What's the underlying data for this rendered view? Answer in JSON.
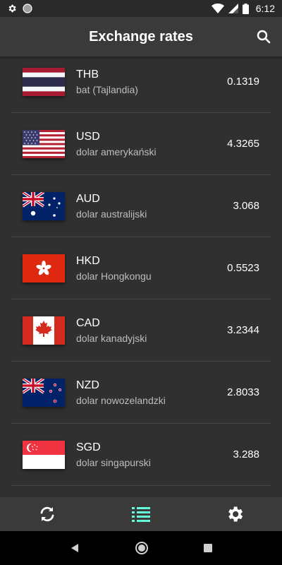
{
  "status": {
    "time": "6:12"
  },
  "app": {
    "title": "Exchange rates"
  },
  "currencies": [
    {
      "code": "THB",
      "name": "bat (Tajlandia)",
      "rate": "0.1319",
      "flag": "thailand"
    },
    {
      "code": "USD",
      "name": "dolar amerykański",
      "rate": "4.3265",
      "flag": "usa"
    },
    {
      "code": "AUD",
      "name": "dolar australijski",
      "rate": "3.068",
      "flag": "australia"
    },
    {
      "code": "HKD",
      "name": "dolar Hongkongu",
      "rate": "0.5523",
      "flag": "hong-kong"
    },
    {
      "code": "CAD",
      "name": "dolar kanadyjski",
      "rate": "3.2344",
      "flag": "canada"
    },
    {
      "code": "NZD",
      "name": "dolar nowozelandzki",
      "rate": "2.8033",
      "flag": "new-zealand"
    },
    {
      "code": "SGD",
      "name": "dolar singapurski",
      "rate": "3.288",
      "flag": "singapore"
    }
  ],
  "nav": {
    "items": [
      {
        "icon": "refresh-icon",
        "active": false
      },
      {
        "icon": "list-icon",
        "active": true
      },
      {
        "icon": "settings-icon",
        "active": false
      }
    ]
  },
  "colors": {
    "accent": "#64ffda",
    "background": "#303030",
    "app_bar": "#3a3a3a"
  }
}
